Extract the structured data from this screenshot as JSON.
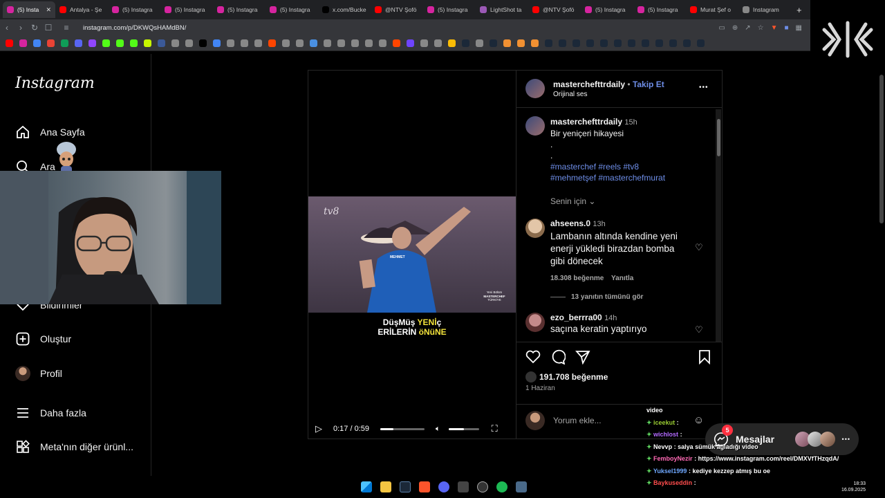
{
  "browser": {
    "tabs": [
      {
        "label": "(5) Insta",
        "color": "#d6249f",
        "active": true
      },
      {
        "label": "Antalya - Şe",
        "color": "#ff0000"
      },
      {
        "label": "(5) Instagra",
        "color": "#d6249f"
      },
      {
        "label": "(5) Instagra",
        "color": "#d6249f"
      },
      {
        "label": "(5) Instagra",
        "color": "#d6249f"
      },
      {
        "label": "(5) Instagra",
        "color": "#d6249f"
      },
      {
        "label": "x.com/Bucke",
        "color": "#000000"
      },
      {
        "label": "@NTV Şofö",
        "color": "#ff0000"
      },
      {
        "label": "(5) Instagra",
        "color": "#d6249f"
      },
      {
        "label": "LightShot ta",
        "color": "#9b59b6"
      },
      {
        "label": "@NTV Şofö",
        "color": "#ff0000"
      },
      {
        "label": "(5) Instagra",
        "color": "#d6249f"
      },
      {
        "label": "(5) Instagra",
        "color": "#d6249f"
      },
      {
        "label": "Murat Şef o",
        "color": "#ff0000"
      },
      {
        "label": "Instagram",
        "color": "#888888"
      }
    ],
    "tab_close": "✕",
    "new_tab": "+",
    "url": "instagram.com/p/DKWQsHAMdBN/",
    "bookmark_colors": [
      "#ff0000",
      "#d6249f",
      "#4285f4",
      "#ea4335",
      "#0f9d58",
      "#5865f2",
      "#9146ff",
      "#53fc18",
      "#53fc18",
      "#53fc18",
      "#c7f700",
      "#3b5998",
      "#888",
      "#888",
      "#000",
      "#4285f4",
      "#888",
      "#888",
      "#888",
      "#ff4500",
      "#888",
      "#888",
      "#4a90e2",
      "#888",
      "#888",
      "#888",
      "#888",
      "#888",
      "#ff4500",
      "#6e44ff",
      "#888",
      "#888",
      "#fbbc05",
      "#1b2838",
      "#888",
      "#1b2838",
      "#f29132",
      "#f29132",
      "#f29132",
      "#1b2838",
      "#1b2838",
      "#1b2838",
      "#1b2838",
      "#1b2838",
      "#1b2838",
      "#1b2838",
      "#1b2838",
      "#1b2838",
      "#1b2838",
      "#1b2838",
      "#1b2838"
    ]
  },
  "sidebar": {
    "logo": "Instagram",
    "items": [
      {
        "label": "Ana Sayfa",
        "icon": "home-icon"
      },
      {
        "label": "Ara",
        "icon": "search-icon"
      },
      {
        "label": "Bildirimler",
        "icon": "heart-icon"
      },
      {
        "label": "Oluştur",
        "icon": "plus-square-icon"
      },
      {
        "label": "Profil",
        "icon": "profile-avatar"
      },
      {
        "label": "Daha fazla",
        "icon": "menu-icon"
      },
      {
        "label": "Meta'nın diğer ürünl...",
        "icon": "grid-icon"
      }
    ]
  },
  "post": {
    "header_user": "masterchefttrdaily",
    "follow": "Takip Et",
    "dot": "•",
    "audio": "Orijinal ses",
    "more": "•••",
    "caption_user": "masterchefttrdaily",
    "caption_time": "15h",
    "caption_text": "Bir yeniçeri hikayesi",
    "caption_dot1": ".",
    "caption_dot2": ".",
    "hashtags_line1": "#masterchef #reels #tv8",
    "hashtags_line2": "#mehmetşef #masterchefmurat",
    "sort_label": "Senin için",
    "comments": [
      {
        "user": "ahseens.0",
        "time": "13h",
        "text_lines": [
          "Lambanın altında kendine yeni",
          "enerji yükledi birazdan bomba",
          "gibi dönecek"
        ],
        "likes": "18.308 beğenme",
        "reply": "Yanıtla",
        "view_replies": "13 yanıtın tümünü gör"
      },
      {
        "user": "ezo_berrra00",
        "time": "14h",
        "text_lines": [
          "saçına keratin yaptırıyo"
        ]
      }
    ],
    "likes_total": "191.708 beğenme",
    "date": "1 Haziran",
    "comment_placeholder": "Yorum ekle...",
    "video": {
      "watermark": "tv8",
      "logo_line1": "Yeni Bölüm",
      "logo_line2": "MASTERCHEF",
      "logo_line3": "TÜRKİYE",
      "apron_label": "MEHMET",
      "overlay_line1_a": "DüşMüş ",
      "overlay_line1_b": "YENİ",
      "overlay_line1_c": "ç",
      "overlay_line2_a": "ERİLERİN ",
      "overlay_line2_b": "öNüNE",
      "time": "0:17 / 0:59",
      "progress": 0.29
    }
  },
  "chat": {
    "lines": [
      {
        "user": "",
        "color": "#ffffff",
        "text": "video"
      },
      {
        "user": "iceekut",
        "color": "#9acd32",
        "text": ":"
      },
      {
        "user": "wichlost",
        "color": "#b36bff",
        "text": ":"
      },
      {
        "user": "Nevvp",
        "color": "#ffffff",
        "text": ": salya sümük ağladığı video"
      },
      {
        "user": "FemboyNezir",
        "color": "#ff69b4",
        "text": ": https://www.instagram.com/reel/DMXVfTHzqdA/"
      },
      {
        "user": "Yuksel1999",
        "color": "#6fa8ff",
        "text": ": kediye kezzep atmış bu oe"
      },
      {
        "user": "Baykuseddin",
        "color": "#ff4d4d",
        "text": ":"
      }
    ]
  },
  "messages": {
    "label": "Mesajlar",
    "badge": "5",
    "more": "•••"
  },
  "system": {
    "time": "18:33",
    "date": "16.09.2025"
  }
}
